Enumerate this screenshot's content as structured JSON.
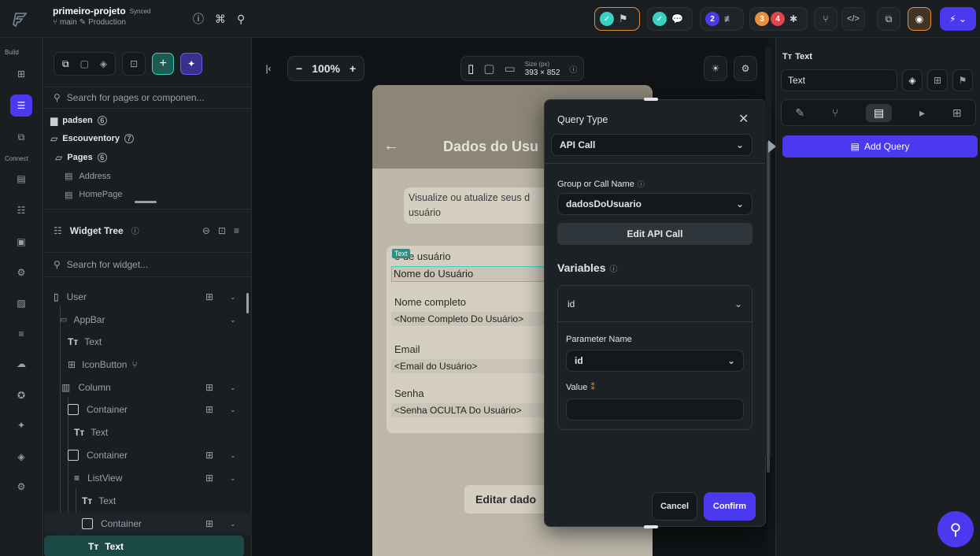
{
  "app": {
    "project_name": "primeiro-projeto",
    "sync_status": "Synced",
    "branch": "main",
    "environment": "Production"
  },
  "topbar": {
    "badge_counts": [
      "2",
      "3",
      "4"
    ]
  },
  "rail": {
    "build_label": "Build",
    "connect_label": "Connect"
  },
  "pages_panel": {
    "search_placeholder": "Search for pages or componen...",
    "folders": [
      {
        "name": "padsen",
        "count": "6"
      },
      {
        "name": "Escouventory",
        "count": "7"
      },
      {
        "name": "Pages",
        "count": "6"
      }
    ],
    "pages": [
      "Address",
      "HomePage"
    ]
  },
  "widget_tree": {
    "title": "Widget Tree",
    "search_placeholder": "Search for widget...",
    "nodes": [
      {
        "label": "User"
      },
      {
        "label": "AppBar"
      },
      {
        "label": "Text"
      },
      {
        "label": "IconButton"
      },
      {
        "label": "Column"
      },
      {
        "label": "Container"
      },
      {
        "label": "Text"
      },
      {
        "label": "Container"
      },
      {
        "label": "ListView"
      },
      {
        "label": "Text"
      },
      {
        "label": "Container"
      },
      {
        "label": "Text"
      }
    ]
  },
  "canvas_toolbar": {
    "zoom": "100%",
    "size_label": "Size (px)",
    "size_value": "393 × 852"
  },
  "phone": {
    "appbar_title": "Dados do Usu",
    "info_text": "Visualize ou atualize seus d usuário",
    "text_tag": "Text",
    "fields": [
      {
        "label": "e de usuário",
        "value": "Nome do Usuário"
      },
      {
        "label": "Nome completo",
        "value": "<Nome Completo Do Usuário>"
      },
      {
        "label": "Email",
        "value": "<Email do Usuário>"
      },
      {
        "label": "Senha",
        "value": "<Senha OCULTA Do Usuário>"
      }
    ],
    "button_label": "Editar dado"
  },
  "query_modal": {
    "title": "Query Type",
    "query_type": "API Call",
    "group_label": "Group or Call Name",
    "group_value": "dadosDoUsuario",
    "edit_button": "Edit API Call",
    "variables_label": "Variables",
    "variable_name": "id",
    "param_label": "Parameter Name",
    "param_value": "id",
    "value_label": "Value",
    "value_input": "",
    "cancel": "Cancel",
    "confirm": "Confirm"
  },
  "props_panel": {
    "widget_type": "Text",
    "widget_name": "Text",
    "add_query": "Add Query"
  },
  "colors": {
    "accent": "#4b39ef",
    "teal": "#39d2c0",
    "background": "#14181b",
    "panel": "#1a1e21"
  }
}
